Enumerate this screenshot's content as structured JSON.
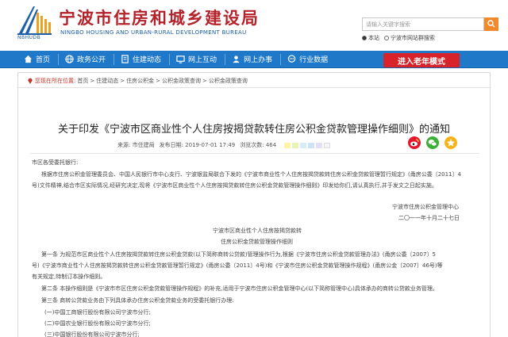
{
  "header": {
    "title": "宁波市住房和城乡建设局",
    "subtitle": "NINGBO HOUSING AND URBAN-RURAL DEVELOPMENT BUREAU",
    "logo_text": "NBHUDB",
    "search_placeholder": "请输入关键字搜索",
    "radio_site": "本站",
    "radio_network": "宁波市网站群搜索"
  },
  "nav": {
    "items": [
      "首页",
      "政务公开",
      "住建动态",
      "网上互动",
      "网上办事",
      "行业数据"
    ],
    "elder_mode": "进入老年模式"
  },
  "breadcrumb": {
    "label": "您现在所在位置:",
    "items": [
      "首页",
      "住建动态",
      "住房公积金",
      "公积金政策查询",
      "公积金政策查询"
    ],
    "sep": ">"
  },
  "article": {
    "title": "关于印发《宁波市区商业性个人住房按揭贷款转住房公积金贷款管理操作细则》的通知",
    "source": "来源: 市住建局",
    "date": "发布日期: 2019-07-01 17:49",
    "views": "浏览次数: 464",
    "swatch_colors": [
      "#fff3a6",
      "#e7f4b8",
      "#d8ecf7",
      "#cfe3f7",
      "#e3dff5",
      "#f4f4f4"
    ],
    "lines": [
      "市区各受委托银行:",
      "根据市住房公积金管理委员会、中国人民银行市中心支行、宁波银监局联合下发的《宁波市商业性个人住房按揭贷款转住房公积金贷款管理暂行规定》(甬房公委〔2011〕4",
      "号)文件精神,结合市区实际情况,经研究决定,现将《宁波市区商业性个人住房按揭贷款转住房公积金贷款管理操作细则》印发给你们,请认真执行,并于发文之日起实施。",
      "宁波市住房公积金管理中心",
      "二〇一一年十月二十七日",
      "宁波市区商业性个人住房按揭贷款转",
      "住房公积金贷款管理操作细则",
      "第一条 为规范市区商业性个人住房按揭贷款转住房公积金贷款(以下简称商转公贷款)管理操作行为,根据《宁波市住房公积金贷款管理办法》(甬房公委〔2007〕5",
      "号)《宁波市商业性个人住房按揭贷款转住房公积金贷款管理暂行规定》(甬房公委〔2011〕4号)和《宁波市住房公积金贷款管理操作规程》(甬房公金〔2007〕46号)等",
      "有关规定,特制订本操作细则。",
      "第二条 本操作细则是《宁波市市区住房公积金贷款管理操作规程》的补充,适用于宁波市住房公积金管理中心(以下简称管理中心)具体承办的商转公贷款业务管理。",
      "第三条 商转公贷款业务由下列具体承办住房公积金贷款业务的受委托银行办理:",
      "(一)中国工商银行股份有限公司宁波市分行;",
      "(二)中国农业银行股份有限公司宁波市分行;",
      "(三)中国银行股份有限公司宁波市分行;"
    ]
  },
  "colors": {
    "nav_blue": "#1f78c8",
    "title_red": "#b4232b",
    "elder_red": "#d9232a",
    "search_orange": "#f18a2c"
  }
}
